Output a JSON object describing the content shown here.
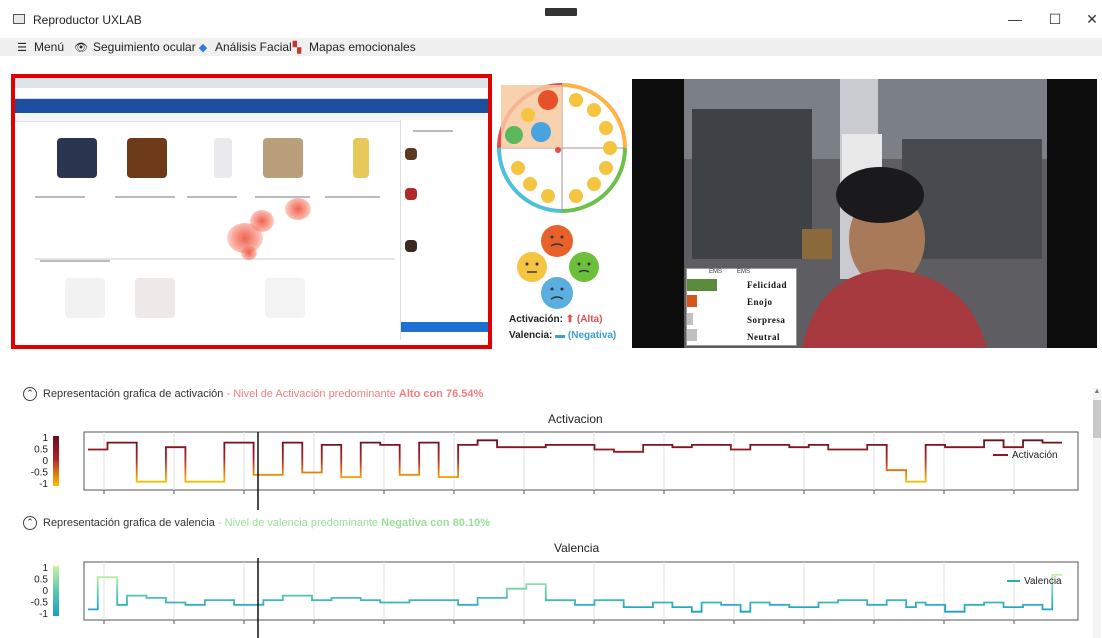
{
  "window": {
    "title": "Reproductor UXLAB",
    "minimize": "—",
    "maximize": "☐",
    "close": "✕"
  },
  "menu": {
    "items": [
      {
        "icon": "hamburger-icon",
        "label": "Menú"
      },
      {
        "icon": "eye-icon",
        "label": "Seguimiento ocular"
      },
      {
        "icon": "face-mask-icon",
        "label": "Análisis Facial"
      },
      {
        "icon": "map-icon",
        "label": "Mapas emocionales"
      }
    ]
  },
  "emotion_legend": {
    "activacion_label": "Activación:",
    "activacion_value": "(Alta)",
    "valencia_label": "Valencia:",
    "valencia_value": "(Negativa)"
  },
  "webcam_panel": {
    "head_left": "EMS",
    "head_right": "EMS",
    "rows": [
      "Felicidad",
      "Enojo",
      "Sorpresa",
      "Neutral"
    ]
  },
  "activation_section": {
    "label": "Representación grafica de activación",
    "dash": "-",
    "summary_prefix": "Nivel de Activación predominante",
    "summary_bold": "Alto con 76.54%",
    "summary_color": "#f08080"
  },
  "valence_section": {
    "label": "Representación grafica de valencia",
    "dash": "-",
    "summary_prefix": "Nivel de valencia predominante",
    "summary_bold": "Negativa con 80.10%",
    "summary_color": "#98e098"
  },
  "charts": {
    "activation": {
      "title": "Activacion",
      "series_name": "Activación",
      "yticks": [
        "1",
        "0.5",
        "0",
        "-0.5",
        "-1"
      ]
    },
    "valence": {
      "title": "Valencia",
      "series_name": "Valencia",
      "yticks": [
        "1",
        "0.5",
        "0",
        "-0.5",
        "-1"
      ]
    }
  },
  "chart_data": [
    {
      "type": "line",
      "title": "Activacion",
      "ylim": [
        -1,
        1
      ],
      "legend": "right",
      "series": [
        {
          "name": "Activación",
          "step": true,
          "x": [
            0,
            2,
            5,
            8,
            10,
            14,
            17,
            20,
            22,
            24,
            26,
            28,
            30,
            32,
            34,
            36,
            38,
            40,
            42,
            44,
            47,
            50,
            52,
            54,
            57,
            60,
            62,
            64,
            66,
            68,
            70,
            72,
            74,
            76,
            78,
            80,
            82,
            84,
            86,
            88,
            90,
            92,
            94,
            96,
            98,
            100
          ],
          "y": [
            0.5,
            0.8,
            -0.9,
            0.6,
            -0.9,
            0.8,
            -0.6,
            0.8,
            -0.5,
            0.7,
            -0.7,
            0.8,
            0.7,
            -0.6,
            0.8,
            -0.7,
            0.7,
            0.9,
            0.6,
            0.6,
            0.7,
            0.7,
            0.5,
            0.4,
            0.7,
            0.6,
            0.7,
            0.7,
            0.5,
            0.7,
            0.7,
            0.6,
            0.7,
            0.5,
            0.5,
            0.7,
            -0.4,
            -0.9,
            0.7,
            0.6,
            0.6,
            0.9,
            0.6,
            0.9,
            0.8,
            0.8
          ]
        }
      ]
    },
    {
      "type": "line",
      "title": "Valencia",
      "ylim": [
        -1,
        1
      ],
      "legend": "right",
      "series": [
        {
          "name": "Valencia",
          "step": true,
          "x": [
            0,
            1,
            3,
            4,
            6,
            8,
            10,
            12,
            15,
            18,
            20,
            23,
            25,
            28,
            30,
            33,
            36,
            38,
            40,
            43,
            45,
            47,
            50,
            52,
            55,
            58,
            60,
            62,
            63,
            65,
            67,
            68,
            70,
            72,
            75,
            77,
            80,
            82,
            84,
            85,
            86,
            88,
            90,
            92,
            94,
            96,
            98,
            99,
            100
          ],
          "y": [
            -0.8,
            0.6,
            -0.6,
            -0.2,
            -0.3,
            -0.5,
            -0.6,
            -0.4,
            -0.6,
            -0.4,
            -0.2,
            -0.4,
            -0.3,
            -0.4,
            -0.5,
            -0.4,
            -0.4,
            -0.6,
            -0.3,
            0.1,
            0.3,
            -0.4,
            -0.6,
            -0.4,
            -0.7,
            -0.5,
            -0.7,
            -0.9,
            -0.5,
            -0.6,
            -0.9,
            -0.5,
            -0.6,
            -0.7,
            -0.5,
            -0.4,
            -0.6,
            -0.4,
            -0.7,
            -0.5,
            -0.6,
            -0.9,
            -0.6,
            -0.5,
            -0.7,
            -0.6,
            -0.8,
            0.7,
            0.7
          ]
        }
      ]
    }
  ]
}
